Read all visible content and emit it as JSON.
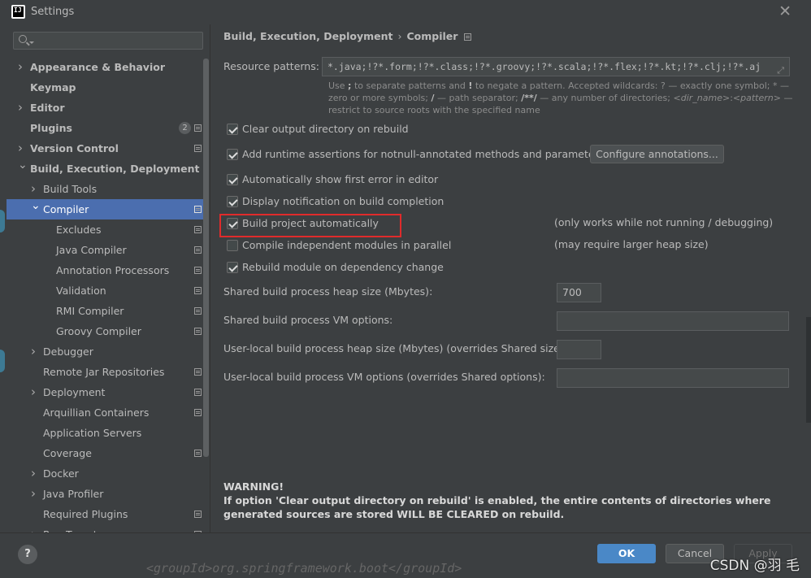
{
  "window": {
    "title": "Settings",
    "app_icon": "IJ"
  },
  "search": {
    "placeholder": ""
  },
  "sidebar": {
    "items": [
      {
        "label": "Appearance & Behavior",
        "bold": true
      },
      {
        "label": "Keymap",
        "bold": true
      },
      {
        "label": "Editor",
        "bold": true
      },
      {
        "label": "Plugins",
        "bold": true,
        "badge": "2"
      },
      {
        "label": "Version Control",
        "bold": true
      },
      {
        "label": "Build, Execution, Deployment",
        "bold": true
      },
      {
        "label": "Build Tools"
      },
      {
        "label": "Compiler",
        "selected": true
      },
      {
        "label": "Excludes"
      },
      {
        "label": "Java Compiler"
      },
      {
        "label": "Annotation Processors"
      },
      {
        "label": "Validation"
      },
      {
        "label": "RMI Compiler"
      },
      {
        "label": "Groovy Compiler"
      },
      {
        "label": "Debugger"
      },
      {
        "label": "Remote Jar Repositories"
      },
      {
        "label": "Deployment"
      },
      {
        "label": "Arquillian Containers"
      },
      {
        "label": "Application Servers"
      },
      {
        "label": "Coverage"
      },
      {
        "label": "Docker"
      },
      {
        "label": "Java Profiler"
      },
      {
        "label": "Required Plugins"
      },
      {
        "label": "Run Targets"
      }
    ]
  },
  "breadcrumb": {
    "parent": "Build, Execution, Deployment",
    "separator": "›",
    "current": "Compiler"
  },
  "resource_patterns": {
    "label": "Resource patterns:",
    "value": "*.java;!?*.form;!?*.class;!?*.groovy;!?*.scala;!?*.flex;!?*.kt;!?*.clj;!?*.aj",
    "help_1": "Use ",
    "help_semicolon": ";",
    "help_2": " to separate patterns and ",
    "help_bang": "!",
    "help_3": " to negate a pattern. Accepted wildcards: ? — exactly one symbol; * — zero or more symbols; ",
    "help_slash": "/",
    "help_4": " — path separator; ",
    "help_doublestar": "/**/",
    "help_5": " — any number of directories; ",
    "help_dirname": "<dir_name>",
    "help_colon": ":",
    "help_pattern": "<pattern>",
    "help_6": " — restrict to source roots with the specified name"
  },
  "options": {
    "clear_output": {
      "label": "Clear output directory on rebuild",
      "checked": true
    },
    "runtime_assertions": {
      "label": "Add runtime assertions for notnull-annotated methods and parameters",
      "checked": true
    },
    "configure_annotations": "Configure annotations...",
    "show_first_error": {
      "label": "Automatically show first error in editor",
      "checked": true
    },
    "display_notification": {
      "label": "Display notification on build completion",
      "checked": true
    },
    "build_automatically": {
      "label": "Build project automatically",
      "checked": true,
      "hint": "(only works while not running / debugging)"
    },
    "compile_parallel": {
      "label": "Compile independent modules in parallel",
      "checked": false,
      "hint": "(may require larger heap size)"
    },
    "rebuild_module": {
      "label": "Rebuild module on dependency change",
      "checked": true
    }
  },
  "fields": {
    "shared_heap": {
      "label": "Shared build process heap size (Mbytes):",
      "value": "700"
    },
    "shared_vm": {
      "label": "Shared build process VM options:",
      "value": ""
    },
    "user_heap": {
      "label": "User-local build process heap size (Mbytes) (overrides Shared size):",
      "value": ""
    },
    "user_vm": {
      "label": "User-local build process VM options (overrides Shared options):",
      "value": ""
    }
  },
  "warning": {
    "title": "WARNING!",
    "text": "If option 'Clear output directory on rebuild' is enabled, the entire contents of directories where generated sources are stored WILL BE CLEARED on rebuild."
  },
  "footer": {
    "help": "?",
    "ok": "OK",
    "cancel": "Cancel",
    "apply": "Apply"
  },
  "watermark": "CSDN @羽 毛",
  "background_code": "<groupId>org.springframework.boot</groupId>",
  "colors": {
    "selection": "#4b6eaf",
    "ok_button": "#4a88c7",
    "highlight_box": "#e02b2b",
    "panel": "#3c3f41"
  }
}
